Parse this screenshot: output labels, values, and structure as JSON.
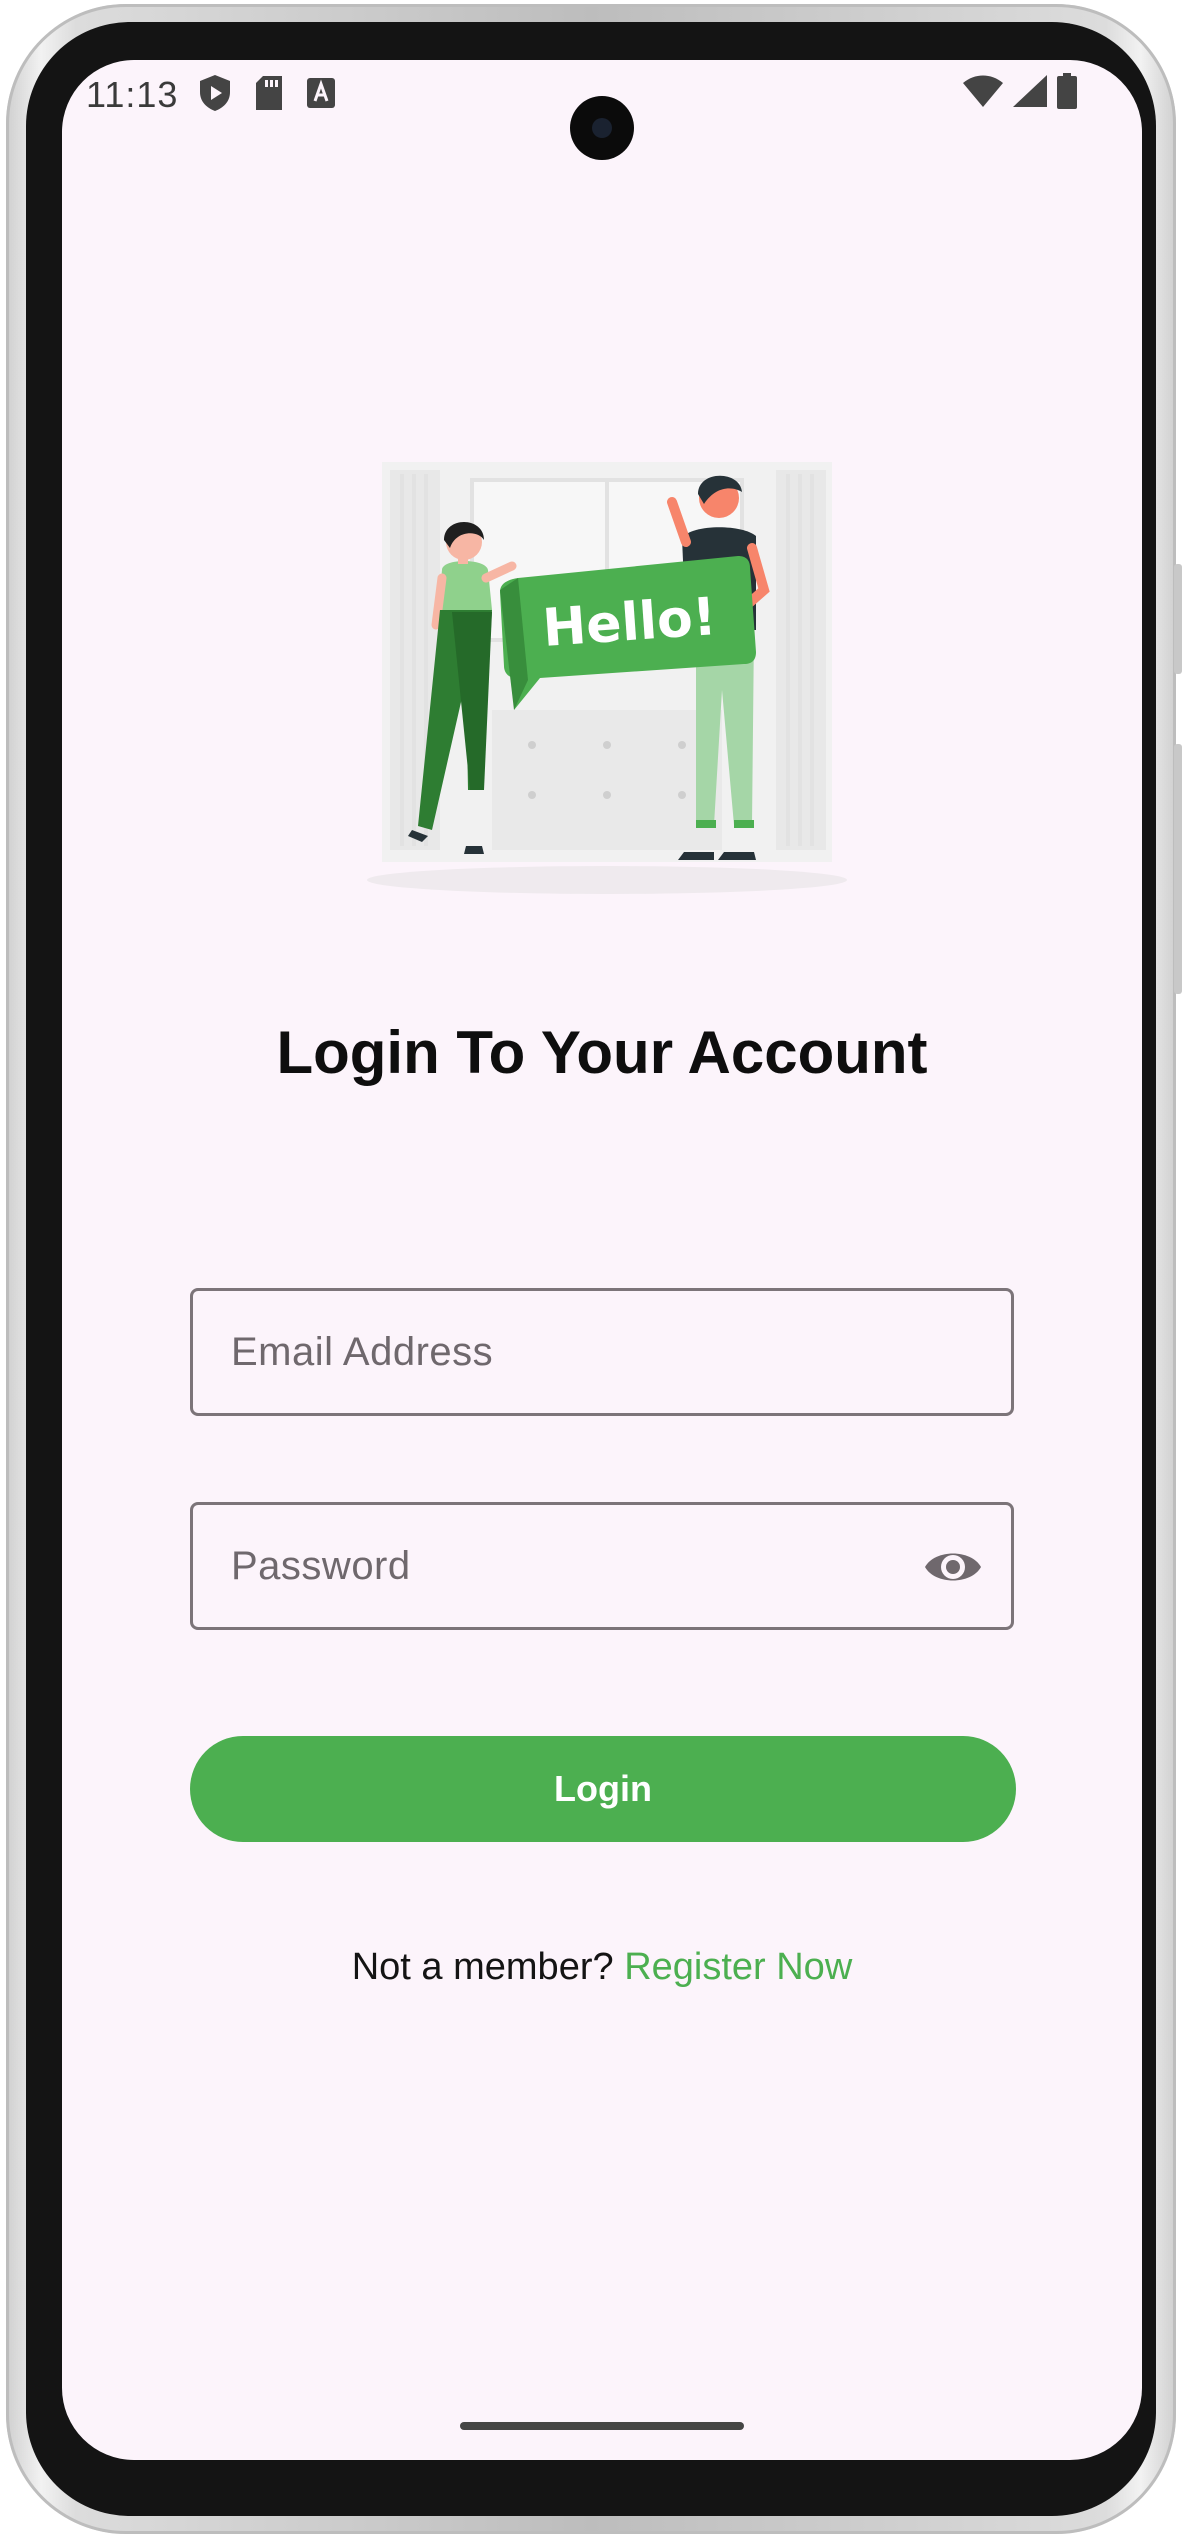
{
  "status_bar": {
    "time": "11:13",
    "left_icons": [
      "shield-play-icon",
      "sd-card-icon",
      "text-a-icon"
    ],
    "right_icons": [
      "wifi-icon",
      "cell-signal-icon",
      "battery-icon"
    ]
  },
  "illustration": {
    "sign_text": "Hello!",
    "description_icon": "greeting-illustration"
  },
  "login": {
    "title": "Login To Your Account",
    "email_placeholder": "Email Address",
    "email_value": "",
    "password_placeholder": "Password",
    "password_value": "",
    "submit_label": "Login",
    "register_prompt": "Not a member?",
    "register_link": "Register Now"
  },
  "colors": {
    "accent": "#4caf50",
    "background": "#fcf4fb",
    "field_border": "#7c7479",
    "title_text": "#0e0e0e"
  }
}
